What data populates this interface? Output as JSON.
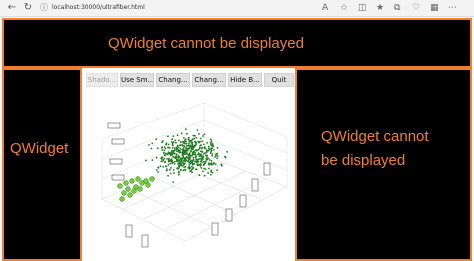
{
  "browser": {
    "url": "localhost:30000/ultrafiber.html",
    "back_icon": "arrow-left-icon",
    "refresh_icon": "refresh-icon",
    "info_icon": "info-icon"
  },
  "panels": {
    "top_text": "QWidget cannot be displayed",
    "left_text": "QWidget",
    "right_line1": "QWidget cannot",
    "right_line2": "be displayed"
  },
  "toolbar": {
    "buttons": [
      {
        "label": "Shado...",
        "enabled": false
      },
      {
        "label": "Use Sm...",
        "enabled": true
      },
      {
        "label": "Chang...",
        "enabled": true
      },
      {
        "label": "Chang...",
        "enabled": true
      },
      {
        "label": "Hide B...",
        "enabled": true
      },
      {
        "label": "Quit",
        "enabled": true
      }
    ]
  },
  "colors": {
    "accent": "#f07f2f",
    "panel_bg": "#000000",
    "scatter_dark": "#1f7a1f",
    "scatter_light": "#7acb3a"
  }
}
